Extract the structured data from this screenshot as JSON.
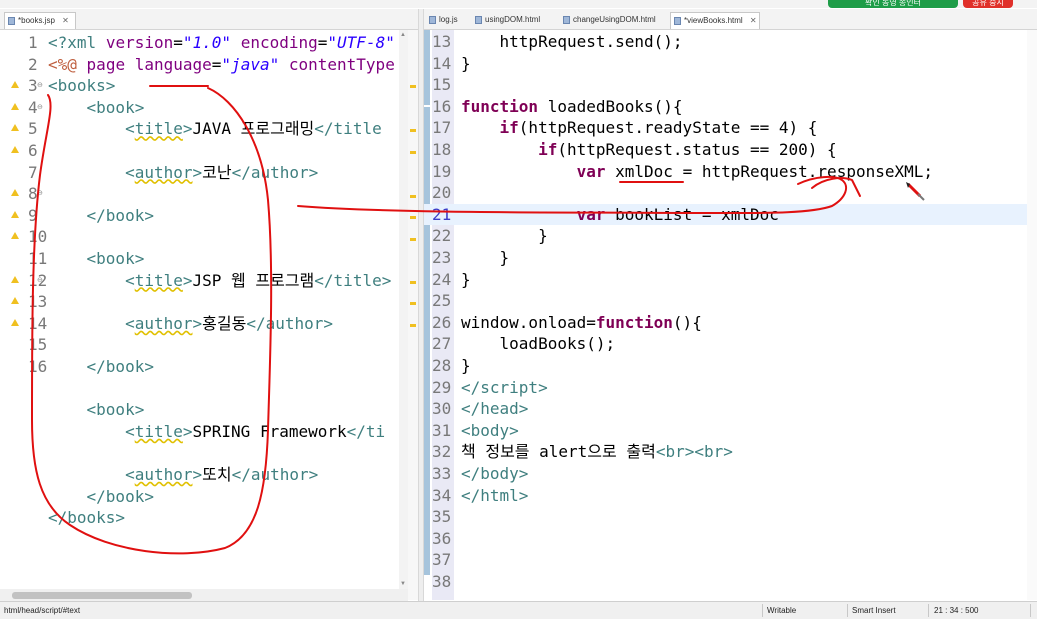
{
  "top": {
    "title_btn": "확인 동영 종인터",
    "stop_btn": "공유 중지"
  },
  "left_tabs": [
    {
      "label": "*books.jsp",
      "close": "✕"
    }
  ],
  "right_tabs": [
    {
      "label": "log.js"
    },
    {
      "label": "usingDOM.html"
    },
    {
      "label": "changeUsingDOM.html"
    },
    {
      "label": "*viewBooks.html",
      "close": "✕"
    }
  ],
  "left_editor": {
    "numbers": [
      "1",
      "2",
      "3",
      "4",
      "5",
      "6",
      "7",
      "8",
      "9",
      "10",
      "11",
      "12",
      "13",
      "14",
      "15",
      "16"
    ]
  },
  "right_editor": {
    "numbers": [
      "13",
      "14",
      "15",
      "16",
      "17",
      "18",
      "19",
      "20",
      "21",
      "22",
      "23",
      "24",
      "25",
      "26",
      "27",
      "28",
      "29",
      "30",
      "31",
      "32",
      "33",
      "34",
      "35",
      "36",
      "37",
      "38"
    ]
  },
  "status": {
    "path": "html/head/script/#text",
    "mode": "Writable",
    "insert": "Smart Insert",
    "position": "21 : 34 : 500"
  }
}
